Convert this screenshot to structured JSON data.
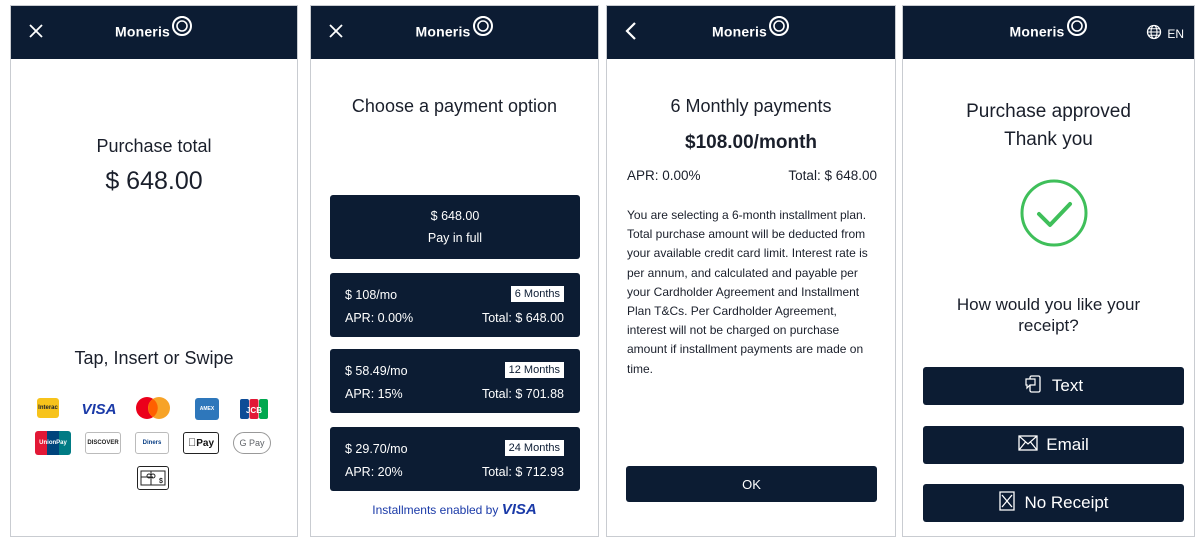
{
  "brand": {
    "name": "Moneris"
  },
  "screen1": {
    "title": "Purchase total",
    "amount": "$ 648.00",
    "prompt": "Tap, Insert or Swipe",
    "cards": [
      "Interac",
      "VISA",
      "Mastercard",
      "American Express",
      "JCB",
      "UnionPay",
      "Discover",
      "Diners Club",
      "Apple Pay",
      "Google Pay",
      "Gift card"
    ],
    "card_labels": {
      "visa": "VISA",
      "jcb": "JCB",
      "discover": "DISCOVER",
      "applepay": "Pay",
      "googlepay": "G Pay"
    }
  },
  "screen2": {
    "title": "Choose a payment option",
    "full": {
      "amount": "$ 648.00",
      "label": "Pay in full"
    },
    "options": [
      {
        "monthly": "$ 108/mo",
        "term": "6 Months",
        "apr": "APR: 0.00%",
        "total": "Total: $ 648.00"
      },
      {
        "monthly": "$ 58.49/mo",
        "term": "12 Months",
        "apr": "APR: 15%",
        "total": "Total: $ 701.88"
      },
      {
        "monthly": "$ 29.70/mo",
        "term": "24 Months",
        "apr": "APR: 20%",
        "total": "Total: $ 712.93"
      }
    ],
    "footer": "Installments enabled by",
    "footer_brand": "VISA"
  },
  "screen3": {
    "title": "6 Monthly payments",
    "amount": "$108.00/month",
    "apr": "APR: 0.00%",
    "total": "Total: $ 648.00",
    "body": "You are selecting a 6-month installment plan. Total purchase amount will be deducted from your available credit card limit. Interest rate is per annum, and calculated and payable per your Cardholder Agreement and Installment Plan T&Cs. Per Cardholder Agreement, interest will not be charged on purchase amount if installment payments are made on time.",
    "ok": "OK"
  },
  "screen4": {
    "lang": "EN",
    "title1": "Purchase approved",
    "title2": "Thank you",
    "question": "How would you like your receipt?",
    "buttons": {
      "text": "Text",
      "email": "Email",
      "none": "No Receipt"
    }
  },
  "colors": {
    "navy": "#0c1c33",
    "success": "#3fbf5a",
    "border": "#c9ccd1"
  },
  "icons": [
    "close-icon",
    "back-icon",
    "globe-icon",
    "check-circle-icon",
    "sms-icon",
    "envelope-icon",
    "no-receipt-icon"
  ]
}
